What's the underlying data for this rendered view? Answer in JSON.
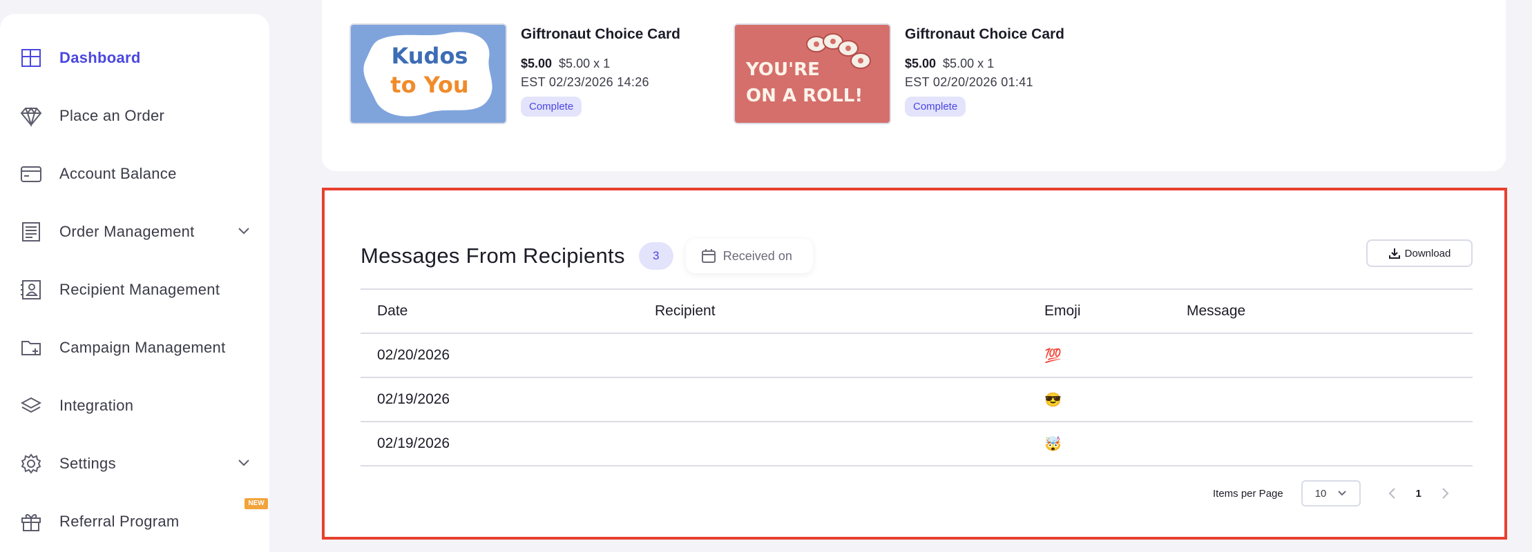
{
  "sidebar": {
    "items": [
      {
        "label": "Dashboard",
        "icon": "layout-icon"
      },
      {
        "label": "Place an Order",
        "icon": "diamond-icon"
      },
      {
        "label": "Account Balance",
        "icon": "credit-card-icon"
      },
      {
        "label": "Order Management",
        "icon": "list-icon"
      },
      {
        "label": "Recipient Management",
        "icon": "contact-card-icon"
      },
      {
        "label": "Campaign Management",
        "icon": "folder-plus-icon"
      },
      {
        "label": "Integration",
        "icon": "layers-icon"
      },
      {
        "label": "Settings",
        "icon": "gear-icon"
      },
      {
        "label": "Referral Program",
        "icon": "gift-icon"
      }
    ],
    "new_badge": "NEW"
  },
  "gift_cards": [
    {
      "title": "Giftronaut Choice Card",
      "price": "$5.00",
      "unit": "$5.00 x 1",
      "date": "EST 02/23/2026 14:26",
      "status": "Complete",
      "image_text_1": "Kudos",
      "image_text_2": "to You"
    },
    {
      "title": "Giftronaut Choice Card",
      "price": "$5.00",
      "unit": "$5.00 x 1",
      "date": "EST 02/20/2026 01:41",
      "status": "Complete",
      "image_text_1": "YOU'RE",
      "image_text_2": "ON A ROLL!"
    }
  ],
  "messages": {
    "title": "Messages From Recipients",
    "count": "3",
    "filter_label": "Received on",
    "download_label": "Download",
    "columns": [
      "Date",
      "Recipient",
      "Emoji",
      "Message"
    ],
    "rows": [
      {
        "date": "02/20/2026",
        "recipient": "",
        "emoji": "💯",
        "message": ""
      },
      {
        "date": "02/19/2026",
        "recipient": "",
        "emoji": "😎",
        "message": ""
      },
      {
        "date": "02/19/2026",
        "recipient": "",
        "emoji": "🤯",
        "message": ""
      }
    ],
    "items_per_page_label": "Items per Page",
    "items_per_page_value": "10",
    "current_page": "1"
  },
  "colors": {
    "accent": "#4a46e0",
    "highlight_border": "#e8402f",
    "badge_new": "#f2a33a"
  }
}
